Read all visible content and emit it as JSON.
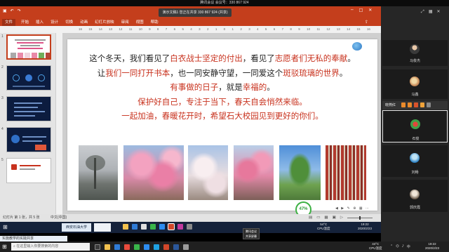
{
  "meeting_bar": {
    "title": "腾讯会议 会议号：330 867 924"
  },
  "ppt": {
    "share_banner": "演示文稿1  您正在共享 330 867 924 (共享)",
    "tabs": [
      "文件",
      "开始",
      "插入",
      "设计",
      "切换",
      "动画",
      "幻灯片放映",
      "审阅",
      "视图",
      "帮助"
    ],
    "ruler": [
      "16",
      "15",
      "14",
      "13",
      "12",
      "11",
      "10",
      "9",
      "8",
      "7",
      "6",
      "5",
      "4",
      "3",
      "2",
      "1",
      "0",
      "1",
      "2",
      "3",
      "4",
      "5",
      "6",
      "7",
      "8",
      "9",
      "10",
      "11",
      "12",
      "13",
      "14",
      "15",
      "16"
    ],
    "thumbnails": [
      "1",
      "2",
      "3",
      "4",
      "5"
    ],
    "slide": {
      "highlight_color": "#c8321e",
      "lines": [
        [
          {
            "text": "这个冬天，我们看见了",
            "highlight": false
          },
          {
            "text": "白衣战士坚定的付出",
            "highlight": true
          },
          {
            "text": "，看见了",
            "highlight": false
          },
          {
            "text": "志愿者们无私的奉献",
            "highlight": true
          },
          {
            "text": "。",
            "highlight": false
          }
        ],
        [
          {
            "text": "让",
            "highlight": false
          },
          {
            "text": "我们一同打开书本",
            "highlight": true
          },
          {
            "text": "，也一同安静守望，一同爱这个",
            "highlight": false
          },
          {
            "text": "斑驳琉璃的世界",
            "highlight": true
          },
          {
            "text": "。",
            "highlight": false
          }
        ],
        [
          {
            "text": "有事做的日子",
            "highlight": true
          },
          {
            "text": "，就是",
            "highlight": false
          },
          {
            "text": "幸福的",
            "highlight": true
          },
          {
            "text": "。",
            "highlight": false
          }
        ],
        [
          {
            "text": "保护好自己，专注于当下，春天自会悄然来临。",
            "highlight": true
          }
        ],
        [
          {
            "text": "一起加油，春暖花开时，希望石大校园见到更好的你们。",
            "highlight": true
          }
        ]
      ],
      "photos": [
        "misty-park-photo",
        "pink-blossom-photo",
        "white-blossom-photo",
        "pink-blossom-closeup-photo",
        "green-tree-photo",
        "library-shelves-photo"
      ],
      "logo_icon": "university-logo-icon"
    },
    "speed_widget": {
      "percent": "47%"
    },
    "status": {
      "slide_info": "幻灯片 第 1 张，共 5 张",
      "language": "中文(中国)"
    }
  },
  "shared_taskbar": {
    "chip": "西安石油大学",
    "temp": "54°C",
    "temp_label": "CPU温度",
    "time": "19:22",
    "date": "2020/2/23"
  },
  "tooltip": {
    "line1": "腾讯会议",
    "line2": "共享屏幕"
  },
  "strip": {
    "text": "实施教学的实践共享"
  },
  "local_taskbar": {
    "search_placeholder": "在这里输入你要搜索的内容",
    "temp": "44°C",
    "temp_label": "CPU温度",
    "time": "19:22",
    "date": "2020/2/23"
  },
  "participants": {
    "tiles": [
      {
        "name": "马俊杰"
      },
      {
        "name": "马鑫"
      },
      {
        "name": "石俊"
      },
      {
        "name": "刘畅"
      },
      {
        "name": "郭庆霞"
      }
    ],
    "speaker": "晓燕红"
  }
}
